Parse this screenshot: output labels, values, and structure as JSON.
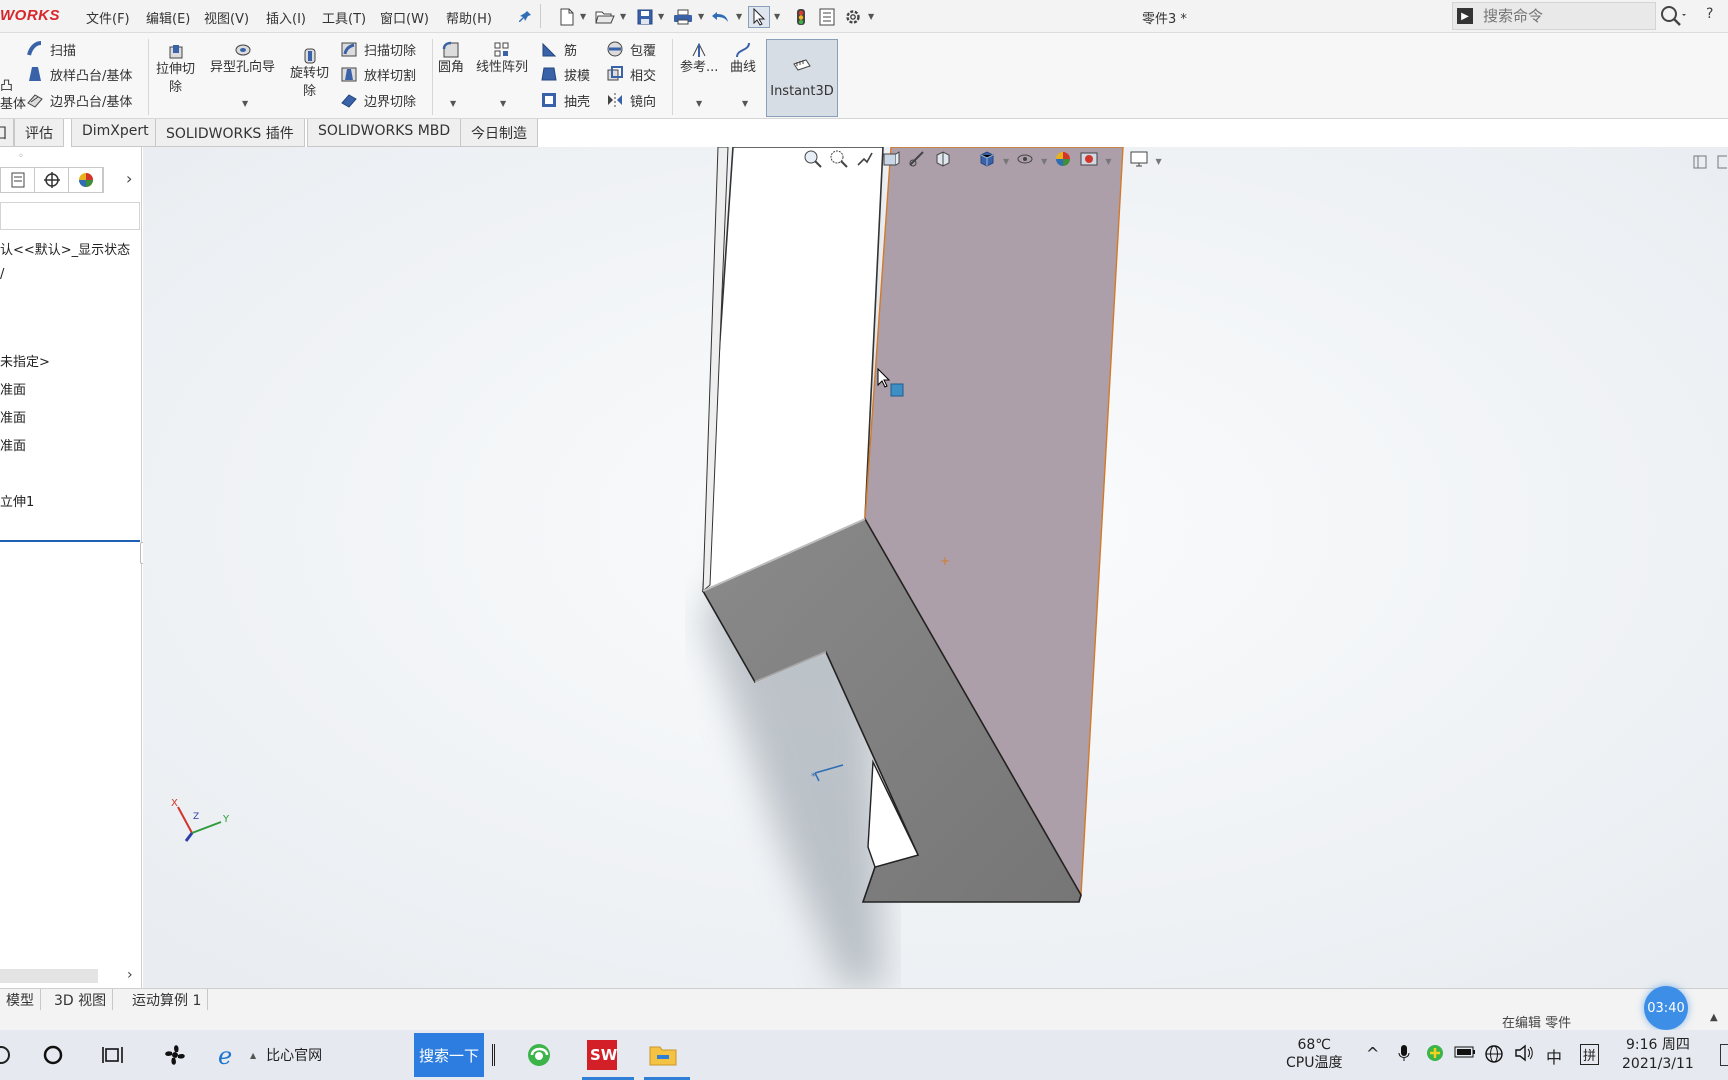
{
  "app": {
    "logo_text": "WORKS",
    "document_title": "零件3 *",
    "menu": [
      "文件(F)",
      "编辑(E)",
      "视图(V)",
      "插入(I)",
      "工具(T)",
      "窗口(W)",
      "帮助(H)"
    ],
    "search_placeholder": "搜索命令"
  },
  "ribbon": {
    "left_partial_1": "凸",
    "left_partial_2": "基体",
    "sweep": "扫描",
    "loft_boss": "放样凸台/基体",
    "boundary_boss": "边界凸台/基体",
    "extrude_cut_1": "拉伸切",
    "extrude_cut_2": "除",
    "hole_wizard": "异型孔向导",
    "revolve_cut_1": "旋转切",
    "revolve_cut_2": "除",
    "sweep_cut": "扫描切除",
    "loft_cut": "放样切割",
    "boundary_cut": "边界切除",
    "fillet": "圆角",
    "linear_pattern": "线性阵列",
    "rib": "筋",
    "draft": "拔模",
    "shell": "抽壳",
    "wrap": "包覆",
    "intersect": "相交",
    "mirror": "镜向",
    "reference": "参考...",
    "curves": "曲线",
    "instant3d": "Instant3D"
  },
  "tabs": [
    "囗",
    "评估",
    "DimXpert",
    "SOLIDWORKS 插件",
    "SOLIDWORKS MBD",
    "今日制造"
  ],
  "feature_tree": {
    "items": [
      "认<<默认>_显示状态",
      "/",
      "未指定>",
      "准面",
      "准面",
      "准面",
      "立伸1"
    ]
  },
  "model_tabs": [
    "模型",
    "3D 视图",
    "运动算例 1"
  ],
  "status": {
    "editing": "在编辑 零件"
  },
  "taskbar": {
    "browser_label": "比心官网",
    "search_button": "搜索一下",
    "temperature": "68℃",
    "temperature_label": "CPU温度",
    "ime_lang": "中",
    "ime_mode": "拼",
    "time": "9:16 周四",
    "date": "2021/3/11"
  },
  "overlay": {
    "timer": "03:40"
  },
  "colors": {
    "brand_red": "#d8262d",
    "selected_face": "#ad9fa9",
    "edge_highlight": "#d27a2a",
    "accent_blue": "#2f7fd6"
  }
}
